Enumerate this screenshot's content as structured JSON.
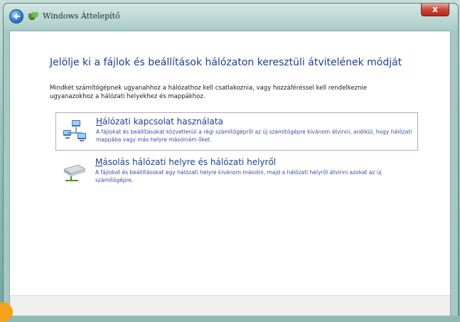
{
  "window": {
    "title": "Windows Áttelepítő",
    "close_label": "x"
  },
  "page": {
    "heading": "Jelölje ki a fájlok és beállítások hálózaton keresztüli átvitelének módját",
    "intro": "Mindkét számítógépnek ugyanahhoz a hálózathoz kell csatlakoznia, vagy hozzáféréssel kell rendelkeznie ugyanazokhoz a hálózati helyekhez és mappákhoz."
  },
  "options": [
    {
      "title_accel": "H",
      "title_rest": "álózati kapcsolat használata",
      "description": "A fájlokat és beállításokat közvetlenül a régi számítógépről az új számítógépre kívánom átvinni, anélkül, hogy hálózati mappába vagy más helyre másolnám őket.",
      "icon": "network-computers-icon"
    },
    {
      "title_accel": "M",
      "title_rest": "ásolás hálózati helyre és hálózati helyről",
      "description": "A fájlokat és beállításokat egy hálózati helyre kívánom másolni, majd a hálózati helyről átvinni azokat az új számítógépre.",
      "icon": "network-drive-icon"
    }
  ],
  "colors": {
    "heading": "#1c3f94",
    "link": "#1c3f94",
    "close_button": "#c9473a"
  }
}
